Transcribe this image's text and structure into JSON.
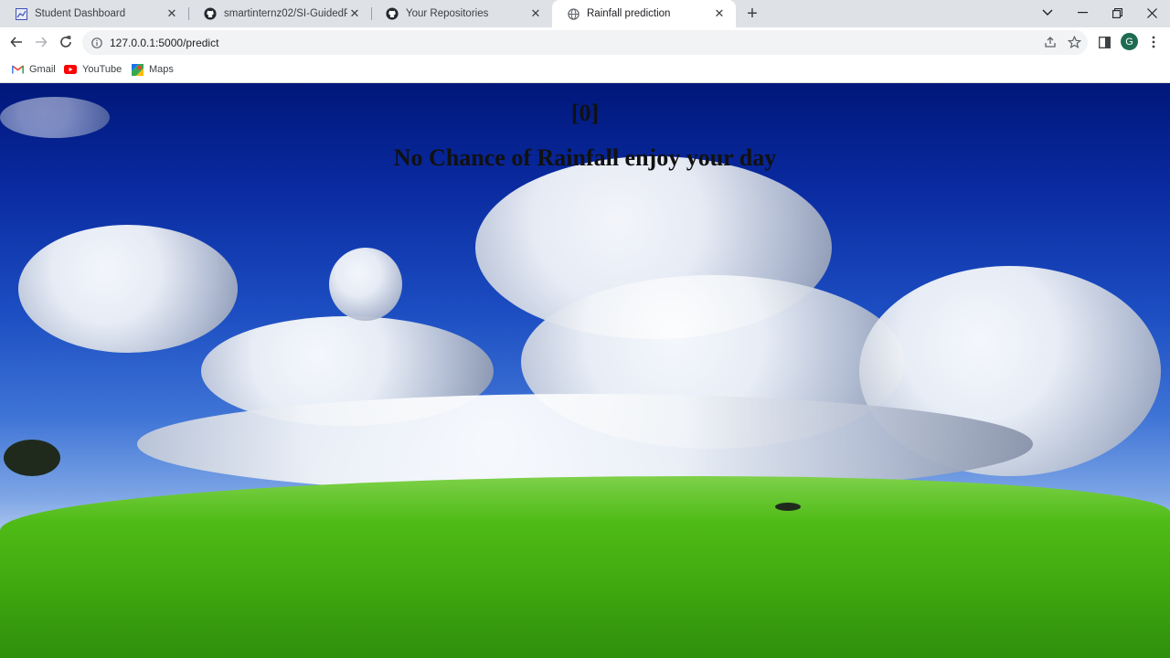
{
  "browser": {
    "tabs": [
      {
        "label": "Student Dashboard",
        "icon": "dashboard-icon",
        "active": false
      },
      {
        "label": "smartinternz02/SI-GuidedProjec",
        "icon": "github-icon",
        "active": false
      },
      {
        "label": "Your Repositories",
        "icon": "github-icon",
        "active": false
      },
      {
        "label": "Rainfall prediction",
        "icon": "globe-icon",
        "active": true
      }
    ],
    "url": "127.0.0.1:5000/predict",
    "profile_initial": "G",
    "bookmarks": [
      {
        "label": "Gmail",
        "icon": "gmail-icon"
      },
      {
        "label": "YouTube",
        "icon": "youtube-icon"
      },
      {
        "label": "Maps",
        "icon": "maps-icon"
      }
    ]
  },
  "page": {
    "prediction_code": "[0]",
    "prediction_message": "No Chance of Rainfall enjoy your day"
  }
}
